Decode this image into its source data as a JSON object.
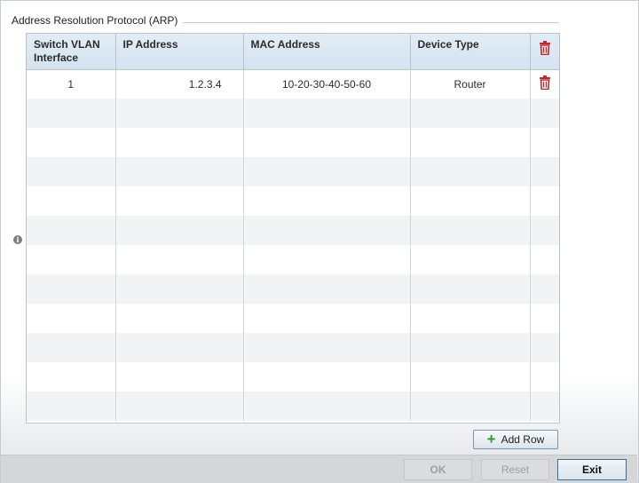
{
  "group": {
    "title": "Address Resolution Protocol (ARP)"
  },
  "table": {
    "headers": {
      "switch_vlan": "Switch VLAN Interface",
      "ip": "IP Address",
      "mac": "MAC Address",
      "device_type": "Device Type"
    },
    "rows": [
      {
        "switch_vlan": "1",
        "ip": "1.2.3.4",
        "mac": "10-20-30-40-50-60",
        "device_type": "Router"
      }
    ]
  },
  "buttons": {
    "add_row": "Add Row",
    "ok": "OK",
    "reset": "Reset",
    "exit": "Exit"
  },
  "colors": {
    "trash": "#c62828",
    "add_plus": "#2f9a2f",
    "header_bg": "#d9e7f1"
  },
  "icons": {
    "delete": "trash-icon",
    "add": "plus-icon",
    "info": "info-icon"
  }
}
